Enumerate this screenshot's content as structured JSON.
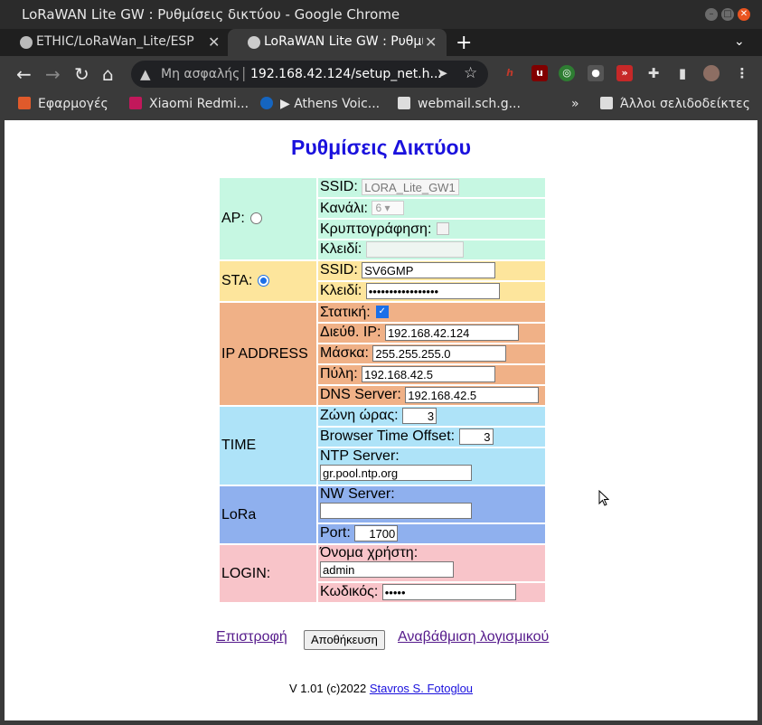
{
  "window": {
    "title": "LoRaWAN Lite GW : Ρυθμίσεις δικτύου - Google Chrome"
  },
  "tabs": [
    {
      "label": "ETHIC/LoRaWan_Lite/ESP",
      "active": false
    },
    {
      "label": "LoRaWAN Lite GW : Ρυθμί",
      "active": true
    }
  ],
  "toolbar": {
    "security_label": "Μη ασφαλής",
    "url": "192.168.42.124/setup_net.h..."
  },
  "bookmarks": [
    {
      "label": "Εφαρμογές"
    },
    {
      "label": "Xiaomi Redmi..."
    },
    {
      "label": "▶ Athens Voic..."
    },
    {
      "label": "webmail.sch.g..."
    }
  ],
  "bookmarks_more": "»",
  "bookmarks_other": "Άλλοι σελιδοδείκτες",
  "page": {
    "heading": "Ρυθμίσεις Δικτύου",
    "ap": {
      "label": "AP:",
      "ssid_label": "SSID:",
      "ssid": "LORA_Lite_GW1",
      "channel_label": "Κανάλι:",
      "channel": "6",
      "encryption_label": "Κρυπτογράφηση:",
      "key_label": "Κλειδί:",
      "key": ""
    },
    "sta": {
      "label": "STA:",
      "ssid_label": "SSID:",
      "ssid": "SV6GMP",
      "key_label": "Κλειδί:",
      "key": "•••••••••••••••••"
    },
    "ip": {
      "label": "IP ADDRESS",
      "static_label": "Στατική:",
      "ip_label": "Διεύθ. IP:",
      "ip": "192.168.42.124",
      "mask_label": "Μάσκα:",
      "mask": "255.255.255.0",
      "gateway_label": "Πύλη:",
      "gateway": "192.168.42.5",
      "dns_label": "DNS Server:",
      "dns": "192.168.42.5"
    },
    "time": {
      "label": "TIME",
      "tz_label": "Ζώνη ώρας:",
      "tz": "3",
      "offset_label": "Browser Time Offset:",
      "offset": "3",
      "ntp_label": "NTP Server:",
      "ntp": "gr.pool.ntp.org"
    },
    "lora": {
      "label": "LoRa",
      "server_label": "NW Server:",
      "server": "",
      "port_label": "Port:",
      "port": "1700"
    },
    "login": {
      "label": "LOGIN:",
      "user_label": "Όνομα χρήστη:",
      "user": "admin",
      "pass_label": "Κωδικός:",
      "pass": "•••••"
    },
    "back_link": "Επιστροφή",
    "save_button": "Αποθήκευση",
    "upgrade_link": "Αναβάθμιση λογισμικού",
    "footer_text": "V 1.01 (c)2022 ",
    "footer_link": "Stavros S. Fotoglou"
  }
}
